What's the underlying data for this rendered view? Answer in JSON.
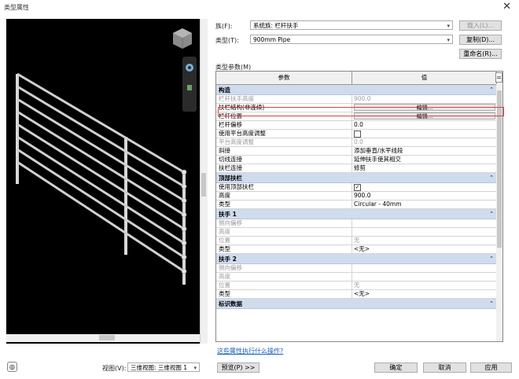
{
  "window": {
    "title": "类型属性",
    "close_glyph": "✕"
  },
  "family": {
    "label": "族(F):",
    "value": "系统族: 栏杆扶手",
    "load_button": "载入(L)..."
  },
  "type": {
    "label": "类型(T):",
    "value": "900mm Pipe",
    "duplicate_button": "复制(D)...",
    "rename_button": "重命名(R)..."
  },
  "type_params_label": "类型参数(M)",
  "grid": {
    "col_param": "参数",
    "col_value": "值",
    "col_toggle": "=",
    "groups": [
      {
        "title": "构造",
        "rows": [
          {
            "param": "栏杆扶手高度",
            "value": "900.0",
            "grey": true
          },
          {
            "param": "扶栏结构(非连续)",
            "value": "编辑...",
            "button": true
          },
          {
            "param": "栏杆位置",
            "value": "编辑...",
            "button": true
          },
          {
            "param": "栏杆偏移",
            "value": "0.0"
          },
          {
            "param": "使用平台高度调整",
            "value": "",
            "checkbox": true,
            "checked": false
          },
          {
            "param": "平台高度调整",
            "value": "0.0",
            "grey": true
          },
          {
            "param": "斜接",
            "value": "添加垂直/水平线段"
          },
          {
            "param": "切线连接",
            "value": "延伸扶手使其相交"
          },
          {
            "param": "扶栏连接",
            "value": "修剪"
          }
        ]
      },
      {
        "title": "顶部扶栏",
        "rows": [
          {
            "param": "使用顶部扶栏",
            "value": "",
            "checkbox": true,
            "checked": true
          },
          {
            "param": "高度",
            "value": "900.0"
          },
          {
            "param": "类型",
            "value": "Circular - 40mm"
          }
        ]
      },
      {
        "title": "扶手 1",
        "rows": [
          {
            "param": "侧向偏移",
            "value": "",
            "grey": true
          },
          {
            "param": "高度",
            "value": "",
            "grey": true
          },
          {
            "param": "位置",
            "value": "无",
            "grey": true
          },
          {
            "param": "类型",
            "value": "<无>"
          }
        ]
      },
      {
        "title": "扶手 2",
        "rows": [
          {
            "param": "侧向偏移",
            "value": "",
            "grey": true
          },
          {
            "param": "高度",
            "value": "",
            "grey": true
          },
          {
            "param": "位置",
            "value": "无",
            "grey": true
          },
          {
            "param": "类型",
            "value": "<无>"
          }
        ]
      },
      {
        "title": "标识数据",
        "rows": []
      }
    ]
  },
  "link": "这些属性执行什么操作?",
  "view": {
    "label": "视图(V):",
    "value": "三维视图: 三维视图 1"
  },
  "buttons": {
    "preview": "预览(P) >>",
    "ok": "确定",
    "cancel": "取消",
    "apply": "应用"
  },
  "colors": {
    "group_bg": "#cfdcee",
    "highlight": "#e04040",
    "link": "#1a5fb4"
  }
}
